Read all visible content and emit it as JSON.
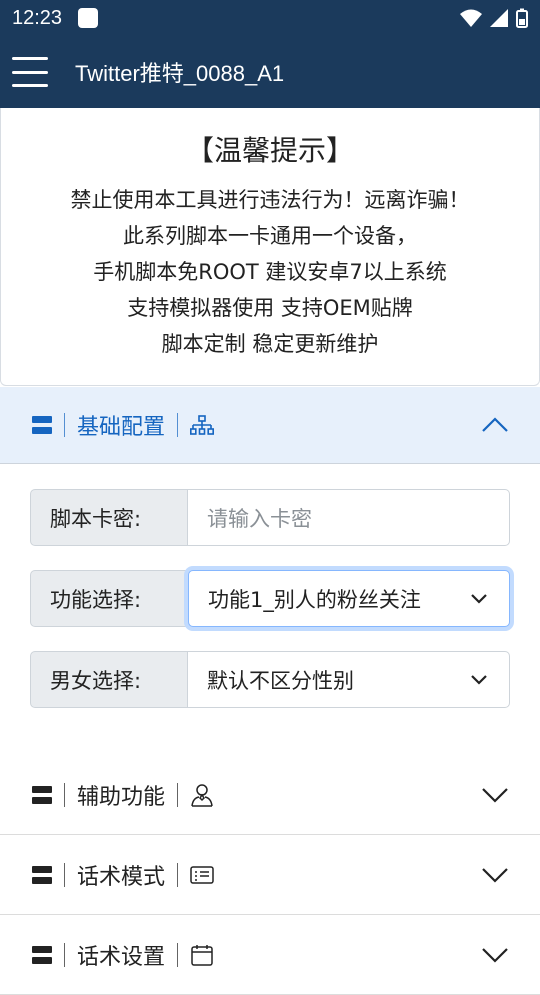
{
  "status_bar": {
    "time": "12:23"
  },
  "app_bar": {
    "title": "Twitter推特_0088_A1"
  },
  "notice": {
    "title": "【温馨提示】",
    "lines": [
      "禁止使用本工具进行违法行为！远离诈骗！",
      "此系列脚本一卡通用一个设备，",
      "手机脚本免ROOT 建议安卓7以上系统",
      "支持模拟器使用 支持OEM贴牌",
      "脚本定制 稳定更新维护"
    ]
  },
  "sections": [
    {
      "title": "基础配置",
      "icon": "sitemap-icon",
      "expanded": true
    },
    {
      "title": "辅助功能",
      "icon": "person-icon",
      "expanded": false
    },
    {
      "title": "话术模式",
      "icon": "id-card-icon",
      "expanded": false
    },
    {
      "title": "话术设置",
      "icon": "calendar-icon",
      "expanded": false
    }
  ],
  "form": {
    "card_key": {
      "label": "脚本卡密:",
      "placeholder": "请输入卡密",
      "value": ""
    },
    "function": {
      "label": "功能选择:",
      "value": "功能1_别人的粉丝关注"
    },
    "gender": {
      "label": "男女选择:",
      "value": "默认不区分性别"
    }
  },
  "colors": {
    "app_bar": "#1b3a5c",
    "accent": "#1565c0",
    "active_section_bg": "#e7f0fb",
    "focus_ring": "#86b7fe"
  }
}
